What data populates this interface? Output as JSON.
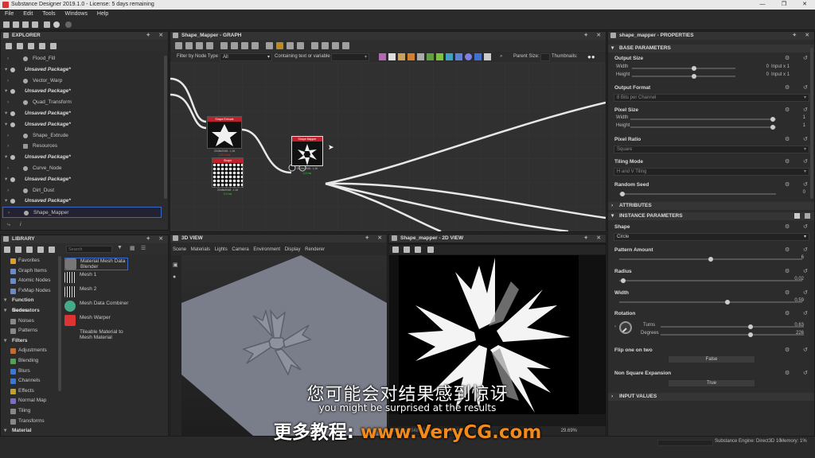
{
  "window": {
    "title": "Substance Designer 2019.1.0 - License: 5 days remaining",
    "controls": [
      "—",
      "❐",
      "✕"
    ]
  },
  "menu": [
    "File",
    "Edit",
    "Tools",
    "Windows",
    "Help"
  ],
  "explorer": {
    "title": "EXPLORER",
    "items": [
      {
        "label": "Flood_Fill",
        "type": "graph"
      },
      {
        "label": "Unsaved Package*",
        "type": "package"
      },
      {
        "label": "Vector_Warp",
        "type": "graph"
      },
      {
        "label": "Unsaved Package*",
        "type": "package"
      },
      {
        "label": "Quad_Transform",
        "type": "graph"
      },
      {
        "label": "Unsaved Package*",
        "type": "package"
      },
      {
        "label": "Unsaved Package*",
        "type": "package"
      },
      {
        "label": "Shape_Extrude",
        "type": "graph"
      },
      {
        "label": "Resources",
        "type": "folder"
      },
      {
        "label": "Unsaved Package*",
        "type": "package"
      },
      {
        "label": "Curve_Node",
        "type": "graph"
      },
      {
        "label": "Unsaved Package*",
        "type": "package"
      },
      {
        "label": "Dirt_Dust",
        "type": "graph"
      },
      {
        "label": "Unsaved Package*",
        "type": "package"
      },
      {
        "label": "Shape_Mapper",
        "type": "graph",
        "selected": true
      }
    ]
  },
  "library": {
    "title": "LIBRARY",
    "search_placeholder": "Search",
    "categories": [
      {
        "label": "Favorites",
        "color": "#e0a020",
        "header": false
      },
      {
        "label": "Graph Items",
        "color": "#6a8ac8",
        "header": false
      },
      {
        "label": "Atomic Nodes",
        "color": "#6a8ac8",
        "header": false
      },
      {
        "label": "FxMap Nodes",
        "color": "#6a8ac8",
        "header": false
      },
      {
        "label": "Function Nodes",
        "color": "#999999",
        "header": true
      },
      {
        "label": "Generators",
        "color": "#999999",
        "header": true
      },
      {
        "label": "Noises",
        "color": "#888888",
        "header": false
      },
      {
        "label": "Patterns",
        "color": "#888888",
        "header": false
      },
      {
        "label": "Filters",
        "color": "#999999",
        "header": true
      },
      {
        "label": "Adjustments",
        "color": "#c86a2a",
        "header": false
      },
      {
        "label": "Blending",
        "color": "#4aa84a",
        "header": false
      },
      {
        "label": "Blurs",
        "color": "#3a78d8",
        "header": false
      },
      {
        "label": "Channels",
        "color": "#3a78d8",
        "header": false
      },
      {
        "label": "Effects",
        "color": "#c8a020",
        "header": false
      },
      {
        "label": "Normal Map",
        "color": "#7a6ad8",
        "header": false
      },
      {
        "label": "Tiling",
        "color": "#888888",
        "header": false
      },
      {
        "label": "Transforms",
        "color": "#888888",
        "header": false
      },
      {
        "label": "Material Filters",
        "color": "#999999",
        "header": true
      }
    ],
    "items": [
      {
        "label": "Material Mesh Data Blender"
      },
      {
        "label": "Mesh 1"
      },
      {
        "label": "Mesh 2"
      },
      {
        "label": "Mesh Data Combiner"
      },
      {
        "label": "Mesh Warper"
      },
      {
        "label": "Tileable Material to Mesh Material"
      }
    ]
  },
  "graph": {
    "title": "Shape_Mapper - GRAPH",
    "filter_label": "Filter by Node Type",
    "filter_value": "All",
    "containing_label": "Containing text or variable",
    "parent_size_label": "Parent Size:",
    "thumbnails_label": "Thumbnails:",
    "nodes": [
      {
        "title": "Shape Extrude",
        "caption": "2048x2048 - L16",
        "time": "122.1 ms",
        "time_color": "#e03030"
      },
      {
        "title": "Shape",
        "caption": "2048x2048 - L16",
        "time": "0.3 ms",
        "time_color": "#30d030"
      },
      {
        "title": "Shape Mapper",
        "caption": "2048x2048 - L16",
        "time": "4.3 ms",
        "time_color": "#30d030"
      }
    ]
  },
  "view3d": {
    "title": "3D VIEW",
    "tabs": [
      "Scene",
      "Materials",
      "Lights",
      "Camera",
      "Environment",
      "Display",
      "Renderer"
    ]
  },
  "view2d": {
    "title": "Shape_mapper - 2D VIEW",
    "status": "2048 x 2048 (Grayscale, 16bpc)",
    "zoom": "29.69%"
  },
  "properties": {
    "title": "shape_mapper - PROPERTIES",
    "base_parameters": "BASE PARAMETERS",
    "output_size": {
      "label": "Output Size",
      "width_label": "Width",
      "height_label": "Height",
      "width_value": "0",
      "height_value": "0",
      "width_rel": "Input x 1",
      "height_rel": "Input x 1"
    },
    "output_format": {
      "label": "Output Format",
      "value": "8 Bits per Channel"
    },
    "pixel_size": {
      "label": "Pixel Size",
      "width_label": "Width",
      "height_label": "Height",
      "width_value": "1",
      "height_value": "1"
    },
    "pixel_ratio": {
      "label": "Pixel Ratio",
      "value": "Square"
    },
    "tiling_mode": {
      "label": "Tiling Mode",
      "value": "H and V Tiling"
    },
    "random_seed": {
      "label": "Random Seed",
      "value": "0"
    },
    "attributes": "ATTRIBUTES",
    "instance_parameters": "INSTANCE PARAMETERS",
    "shape": {
      "label": "Shape",
      "value": "Circle"
    },
    "pattern_amount": {
      "label": "Pattern Amount",
      "value": "6",
      "level": 0.5
    },
    "radius": {
      "label": "Radius",
      "value": "0.02",
      "level": 0.02
    },
    "width": {
      "label": "Width",
      "value": "0.59",
      "level": 0.59
    },
    "rotation": {
      "label": "Rotation",
      "turns_label": "Turns",
      "degrees_label": "Degrees",
      "turns_value": "0.63",
      "degrees_value": "226"
    },
    "flip": {
      "label": "Flip one on two",
      "value": "False"
    },
    "non_square": {
      "label": "Non Square Expansion",
      "value": "True"
    },
    "input_values": "INPUT VALUES"
  },
  "statusbar": {
    "engine": "Substance Engine: Direct3D 10",
    "memory": "Memory: 1%"
  },
  "subtitles": {
    "chinese": "您可能会对结果感到惊讶",
    "english": "you might be surprised at the results",
    "promo_prefix": "更多教程:",
    "promo_url": "www.VeryCG.com"
  }
}
